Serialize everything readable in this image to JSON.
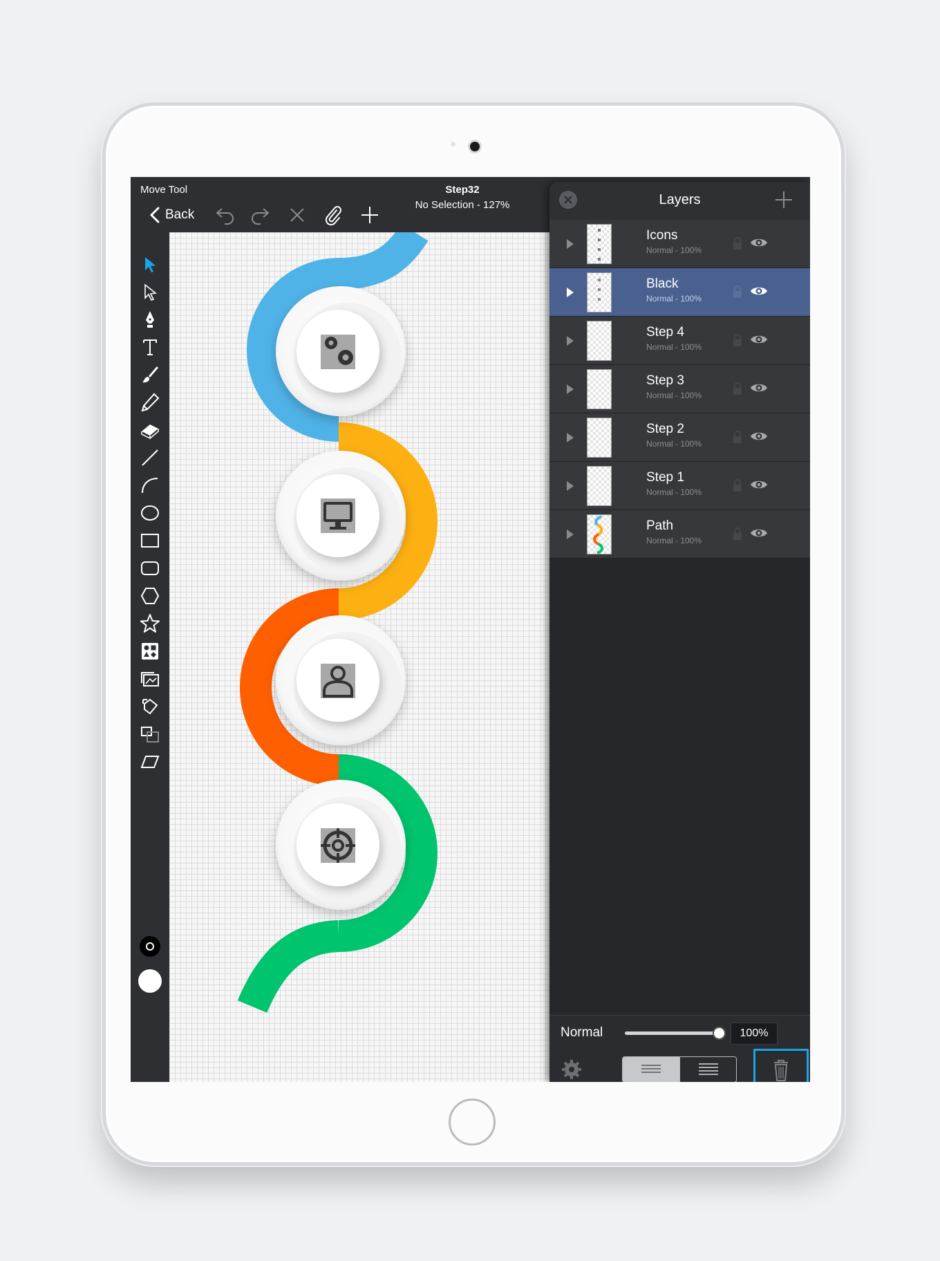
{
  "topbar": {
    "tool_name": "Move Tool",
    "back_label": "Back",
    "doc_title": "Step32",
    "doc_status": "No Selection - 127%"
  },
  "layers_panel": {
    "title": "Layers",
    "layers": [
      {
        "name": "Icons",
        "mode": "Normal - 100%",
        "selected": false
      },
      {
        "name": "Black",
        "mode": "Normal - 100%",
        "selected": true
      },
      {
        "name": "Step 4",
        "mode": "Normal - 100%",
        "selected": false
      },
      {
        "name": "Step 3",
        "mode": "Normal - 100%",
        "selected": false
      },
      {
        "name": "Step 2",
        "mode": "Normal - 100%",
        "selected": false
      },
      {
        "name": "Step 1",
        "mode": "Normal - 100%",
        "selected": false
      },
      {
        "name": "Path",
        "mode": "Normal - 100%",
        "selected": false
      }
    ],
    "blend_mode": "Normal",
    "opacity": "100%",
    "opacity_value": 100
  },
  "colors": {
    "blue": "#4fb3e8",
    "orange": "#fdb011",
    "red": "#fe5f00",
    "green": "#00c46e",
    "selection": "#4a6190",
    "accent": "#1aa4e8"
  },
  "icons": {
    "step1": "gears-icon",
    "step2": "monitor-icon",
    "step3": "user-icon",
    "step4": "target-icon"
  }
}
